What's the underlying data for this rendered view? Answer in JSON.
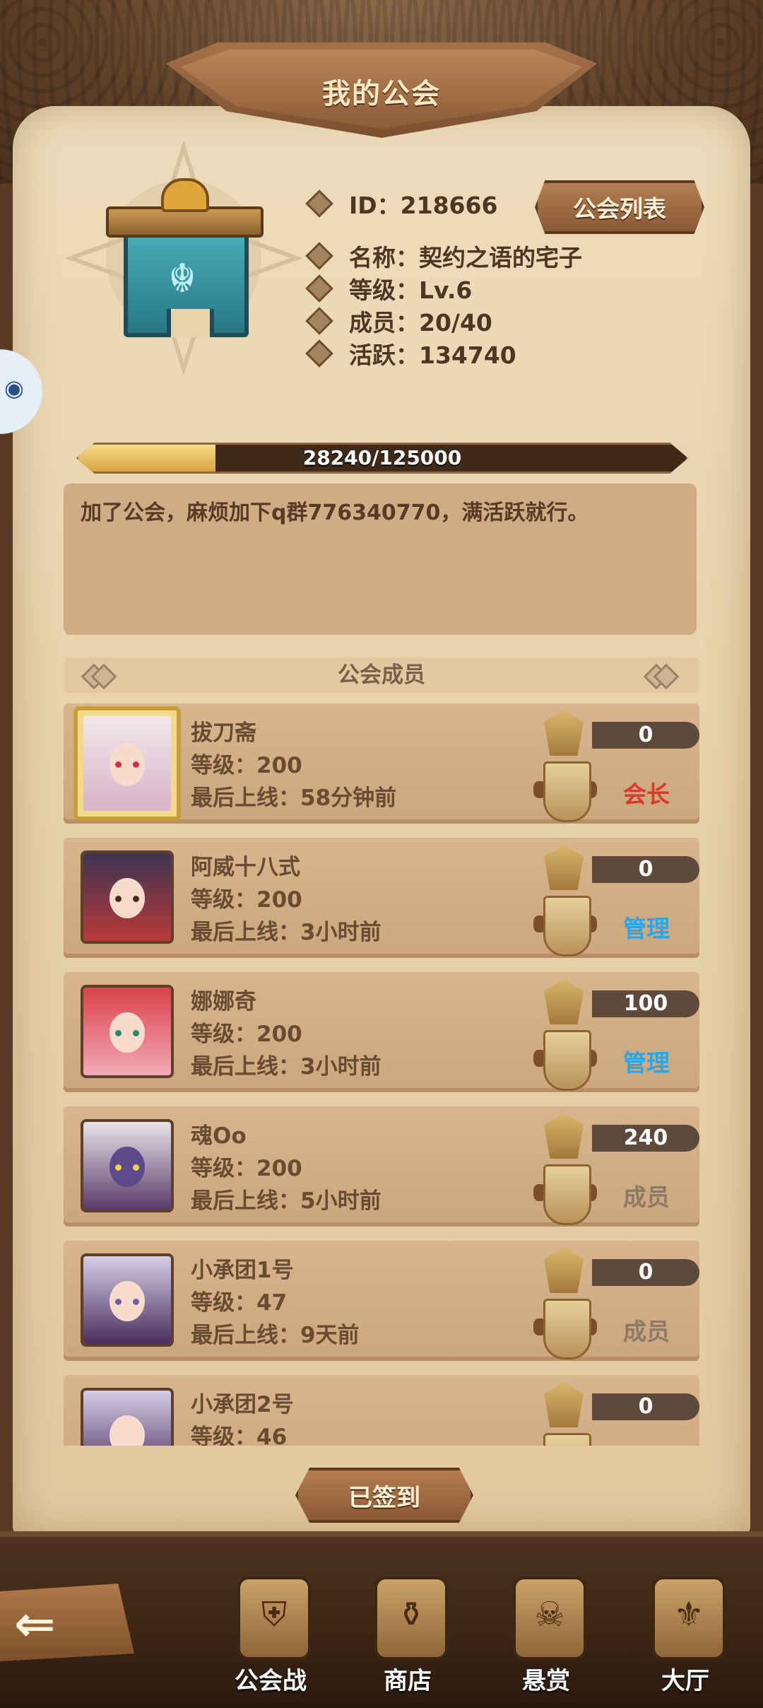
{
  "header": {
    "title": "我的公会"
  },
  "guild": {
    "id_text": "ID：218666",
    "name_text": "名称：契约之语的宅子",
    "level_text": "等级：Lv.6",
    "members_text": "成员：20/40",
    "activity_text": "活跃：134740",
    "list_button": "公会列表",
    "exp": {
      "text": "28240/125000",
      "fraction": 0.2259
    },
    "announcement": "加了公会，麻烦加下q群776340770，满活跃就行。"
  },
  "members_section": {
    "title": "公会成员",
    "members": [
      {
        "name": "拔刀斋",
        "level": "等级：200",
        "last_online": "最后上线：58分钟前",
        "score": "0",
        "role": "会长",
        "role_color": "#d83a2e"
      },
      {
        "name": "阿威十八式",
        "level": "等级：200",
        "last_online": "最后上线：3小时前",
        "score": "0",
        "role": "管理",
        "role_color": "#2aa5e8"
      },
      {
        "name": "娜娜奇",
        "level": "等级：200",
        "last_online": "最后上线：3小时前",
        "score": "100",
        "role": "管理",
        "role_color": "#2aa5e8"
      },
      {
        "name": "魂Oo",
        "level": "等级：200",
        "last_online": "最后上线：5小时前",
        "score": "240",
        "role": "成员",
        "role_color": "#8c7966"
      },
      {
        "name": "小承团1号",
        "level": "等级：47",
        "last_online": "最后上线：9天前",
        "score": "0",
        "role": "成员",
        "role_color": "#8c7966"
      },
      {
        "name": "小承团2号",
        "level": "等级：46",
        "last_online": "",
        "score": "0",
        "role": "",
        "role_color": "#8c7966"
      }
    ]
  },
  "checkin_button": "已签到",
  "bottom_nav": {
    "items": [
      {
        "label": "公会战",
        "icon": "helmet-icon"
      },
      {
        "label": "商店",
        "icon": "shop-bag-icon"
      },
      {
        "label": "悬赏",
        "icon": "bounty-scroll-icon"
      },
      {
        "label": "大厅",
        "icon": "hall-banner-icon"
      }
    ]
  },
  "colors": {
    "accent": "#8a5a36",
    "parchment": "#e8d3ad",
    "progress": "#d6a442"
  }
}
